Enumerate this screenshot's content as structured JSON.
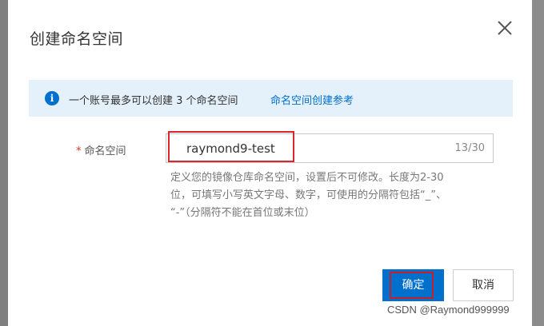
{
  "dialog": {
    "title": "创建命名空间",
    "close_icon": "close-icon"
  },
  "notice": {
    "icon": "info-icon",
    "icon_glyph": "i",
    "text": "一个账号最多可以创建 3 个命名空间",
    "link": "命名空间创建参考"
  },
  "form": {
    "required_mark": "*",
    "label": "命名空间",
    "value": "raymond9-test",
    "count": "13/30",
    "help_lines": [
      "定义您的镜像仓库命名空间，设置后不可修改。长度为2-30",
      "位，可填写小写英文字母、数字，可使用的分隔符包括“_”、",
      "“-”（分隔符不能在首位或末位）"
    ]
  },
  "footer": {
    "ok_label": "确定",
    "cancel_label": "取消"
  },
  "watermark": "CSDN @Raymond999999",
  "colors": {
    "primary": "#0070cc",
    "notice_bg": "#e4f0fa",
    "annotation_red": "#d9262c"
  }
}
